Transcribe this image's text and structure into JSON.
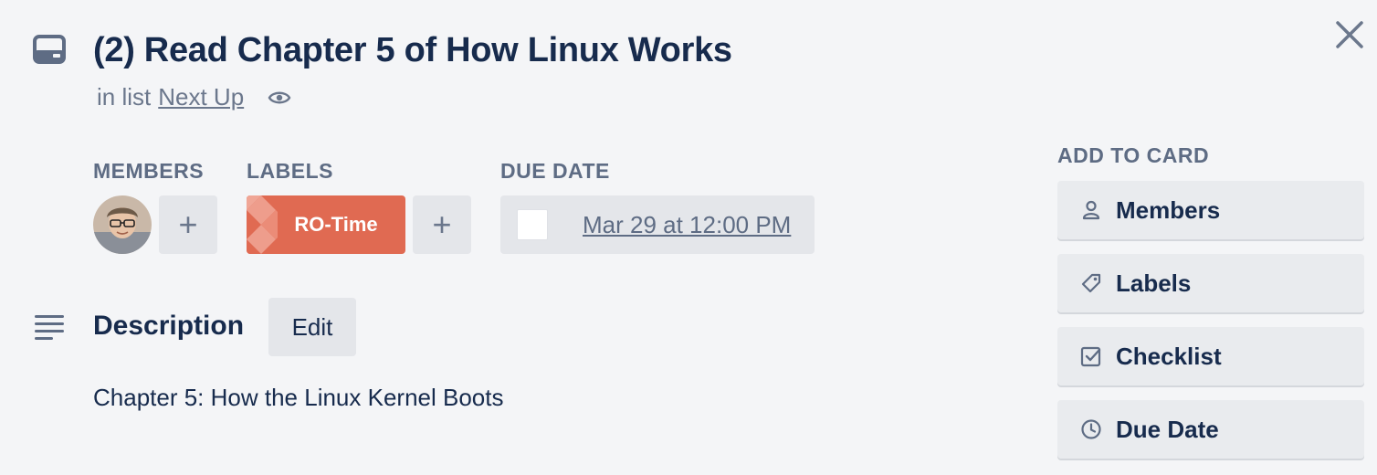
{
  "card": {
    "title": "(2) Read Chapter 5 of How Linux Works",
    "in_list_prefix": "in list",
    "list_name": "Next Up"
  },
  "members": {
    "label": "MEMBERS",
    "add_symbol": "+"
  },
  "labels": {
    "label": "LABELS",
    "items": [
      {
        "name": "RO-Time",
        "color": "#e06a52"
      }
    ],
    "add_symbol": "+"
  },
  "due_date": {
    "label": "DUE DATE",
    "value": "Mar 29 at 12:00 PM"
  },
  "description": {
    "heading": "Description",
    "edit_label": "Edit",
    "text": "Chapter 5: How the Linux Kernel Boots"
  },
  "sidebar": {
    "heading": "ADD TO CARD",
    "buttons": [
      {
        "label": "Members",
        "icon": "person-icon"
      },
      {
        "label": "Labels",
        "icon": "tag-icon"
      },
      {
        "label": "Checklist",
        "icon": "checkbox-icon"
      },
      {
        "label": "Due Date",
        "icon": "clock-icon"
      }
    ]
  },
  "colors": {
    "background": "#f4f5f7",
    "text": "#172b4d",
    "muted": "#5e6c84",
    "label_red": "#e06a52"
  }
}
